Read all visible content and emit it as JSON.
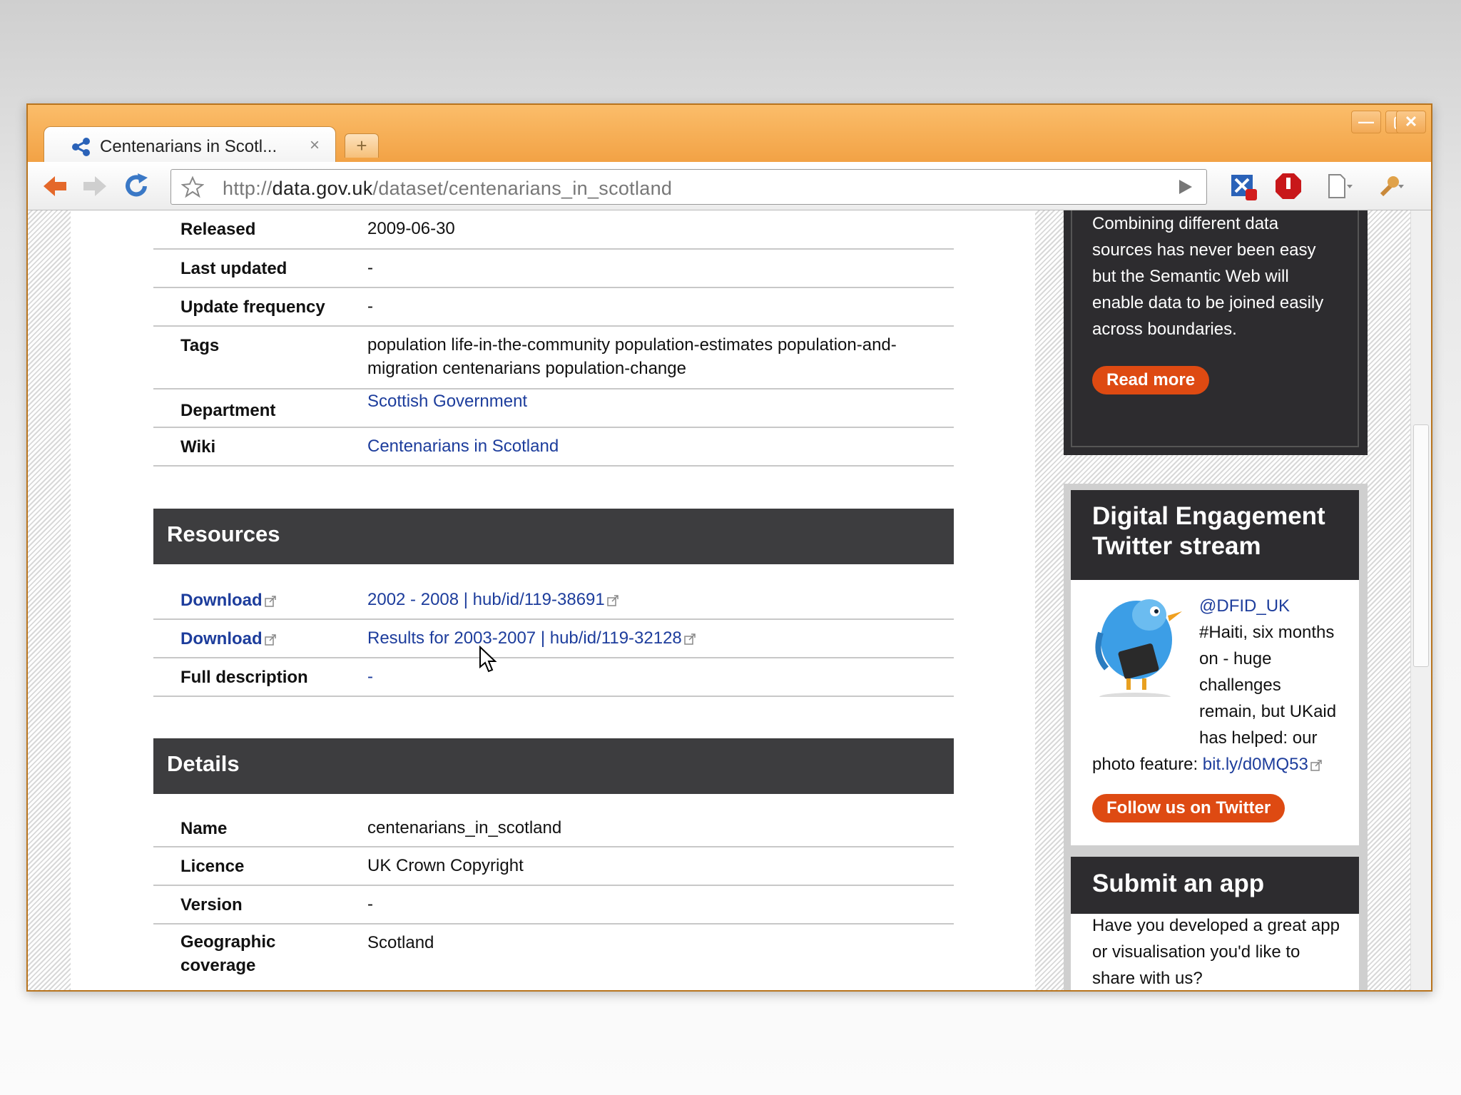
{
  "browser": {
    "tab_title": "Centenarians in Scotl...",
    "tab_close": "×",
    "new_tab": "+",
    "url_scheme": "http://",
    "url_host": "data.gov.uk",
    "url_path": "/dataset/centenarians_in_scotland",
    "window_buttons": {
      "minimize": "—",
      "maximize": "▢",
      "close": "✕"
    }
  },
  "info_rows": [
    {
      "label": "Released",
      "value": "2009-06-30"
    },
    {
      "label": "Last updated",
      "value": "-"
    },
    {
      "label": "Update frequency",
      "value": "-"
    },
    {
      "label": "Tags",
      "value": "population life-in-the-community population-estimates population-and-migration centenarians population-change"
    },
    {
      "label": "Department",
      "value": "Scottish Government"
    },
    {
      "label": "Wiki",
      "value": "Centenarians in Scotland"
    }
  ],
  "resources": {
    "heading": "Resources",
    "rows": [
      {
        "label": "Download",
        "value": "2002 - 2008 | hub/id/119-38691"
      },
      {
        "label": "Download",
        "value": "Results for 2003-2007 | hub/id/119-32128"
      },
      {
        "label": "Full description",
        "value": "-"
      }
    ]
  },
  "details": {
    "heading": "Details",
    "rows": [
      {
        "label": "Name",
        "value": "centenarians_in_scotland"
      },
      {
        "label": "Licence",
        "value": "UK Crown Copyright"
      },
      {
        "label": "Version",
        "value": "-"
      },
      {
        "label": "Geographic coverage",
        "value": "Scotland"
      }
    ]
  },
  "sidebar": {
    "semantic": {
      "text": "Combining different data sources has never been easy but the Semantic Web will enable data to be joined easily across boundaries.",
      "button": "Read more"
    },
    "twitter": {
      "heading": "Digital Engagement Twitter stream",
      "handle": "@DFID_UK",
      "tweet": "#Haiti, six months on - huge challenges remain, but UKaid has helped: our photo feature:",
      "tweet_link": "bit.ly/d0MQ53",
      "button": "Follow us on Twitter"
    },
    "submit_app": {
      "heading": "Submit an app",
      "text": "Have you developed a great app or visualisation you'd like to share with us?"
    }
  },
  "colors": {
    "link": "#1d3d9c",
    "section_header": "#3d3d3f",
    "accent_orange": "#de4a12",
    "window_frame": "#f4a544"
  }
}
